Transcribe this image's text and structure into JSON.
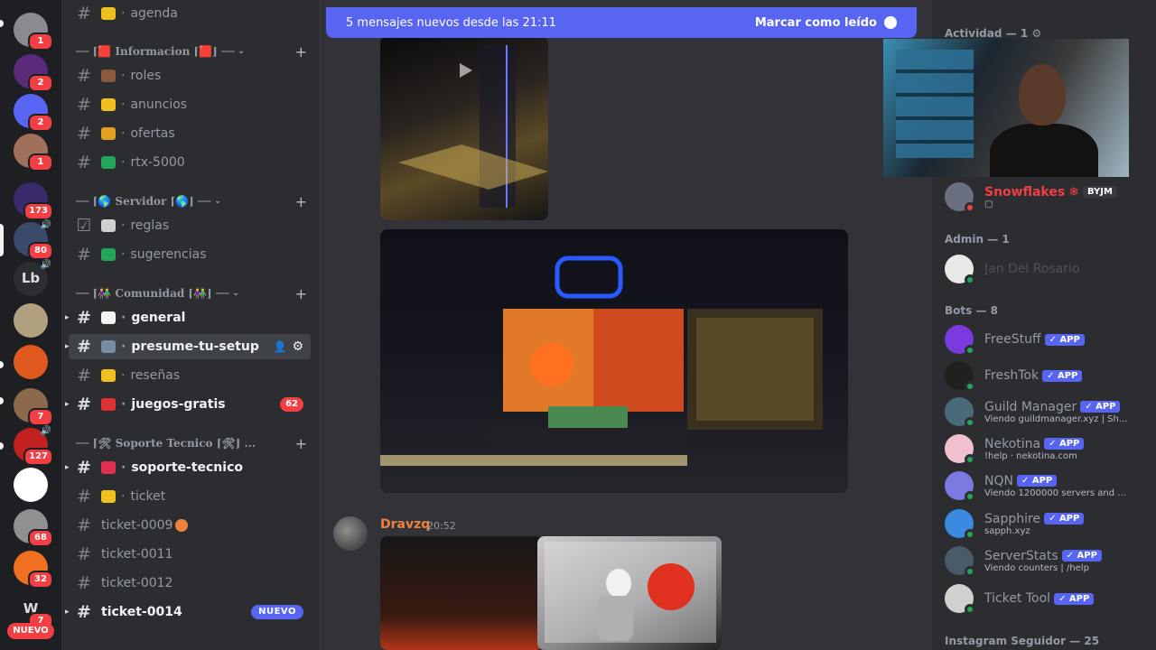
{
  "servers": [
    {
      "badge": "1",
      "color": "#8a8a90"
    },
    {
      "badge": "2",
      "color": "#5a2b7a"
    },
    {
      "badge": "2",
      "color": "#5865f2",
      "icon": "discord-icon"
    },
    {
      "badge": "1",
      "color": "#a0705a"
    },
    {
      "badge": "173",
      "color": "#3a2a6a"
    },
    {
      "badge": "80",
      "color": "#3a4a6a",
      "voice": true
    },
    {
      "badge": "",
      "color": "#2b2d31",
      "label": "Lb",
      "voice": true
    },
    {
      "badge": "",
      "color": "#b0a080"
    },
    {
      "badge": "",
      "color": "#e05a20"
    },
    {
      "badge": "7",
      "color": "#8a6a4a"
    },
    {
      "badge": "127",
      "color": "#c02020",
      "voice": true
    },
    {
      "badge": "",
      "color": "#ffffff"
    },
    {
      "badge": "68",
      "color": "#909090"
    },
    {
      "badge": "32",
      "color": "#f07020"
    },
    {
      "badge": "7",
      "color": "#1e1f22",
      "label": "W"
    }
  ],
  "rail_nuevo": "NUEVO",
  "channels": {
    "top": {
      "name": "agenda",
      "emoji_color": "#f0c020"
    },
    "cat_info": "── ⌈🟥 Informacion ⌈🟥⌋ ──",
    "cat_servidor": "── ⌈🌎 Servidor ⌈🌎⌋ ──",
    "cat_comunidad": "── ⌈👫 Comunidad ⌈👫⌋ ──",
    "cat_soporte": "── ⌈🛠 Soporte Tecnico ⌈🛠⌋ ...",
    "info_list": [
      {
        "name": "roles",
        "emoji_color": "#8a5a3a"
      },
      {
        "name": "anuncios",
        "emoji_color": "#f0c020"
      },
      {
        "name": "ofertas",
        "emoji_color": "#e0a020"
      },
      {
        "name": "rtx-5000",
        "emoji_color": "#23a55a"
      }
    ],
    "servidor_list": [
      {
        "name": "reglas",
        "emoji_color": "#d0d0d0"
      },
      {
        "name": "sugerencias",
        "emoji_color": "#23a55a"
      }
    ],
    "comunidad_list": [
      {
        "name": "general",
        "emoji_color": "#f2f3f5"
      },
      {
        "name": "presume-tu-setup",
        "emoji_color": "#7a8aa0"
      },
      {
        "name": "reseñas",
        "emoji_color": "#f0c020"
      },
      {
        "name": "juegos-gratis",
        "emoji_color": "#e03030",
        "count": "62"
      }
    ],
    "soporte_list": [
      {
        "name": "soporte-tecnico",
        "emoji_color": "#e03050"
      },
      {
        "name": "ticket",
        "emoji_color": "#f0c020"
      },
      {
        "name": "ticket-0009"
      },
      {
        "name": "ticket-0011"
      },
      {
        "name": "ticket-0012"
      },
      {
        "name": "ticket-0014",
        "tag": "NUEVO"
      }
    ]
  },
  "chat": {
    "banner_text": "5 mensajes nuevos desde las 21:11",
    "banner_action": "Marcar como leído",
    "author": "Dravzq",
    "time": "20:52"
  },
  "members": {
    "actividad_header": "Actividad — 1",
    "snowflakes": {
      "name": "Snowflakes",
      "tag": "BYJM"
    },
    "admin_header": "Admin — 1",
    "admin_name": "Jan Del Rosario",
    "bots_header": "Bots — 8",
    "app_label": "APP",
    "bots": [
      {
        "name": "FreeStuff",
        "sub": "",
        "color": "#7a3ae0"
      },
      {
        "name": "FreshTok",
        "sub": "",
        "color": "#202020"
      },
      {
        "name": "Guild Manager",
        "sub": "Viendo guildmanager.xyz | Sh...",
        "color": "#4a6a7a"
      },
      {
        "name": "Nekotina",
        "sub": "!help · nekotina.com",
        "color": "#f0c0d0"
      },
      {
        "name": "NQN",
        "sub": "Viendo 1200000 servers and ...",
        "color": "#7a7ae0"
      },
      {
        "name": "Sapphire",
        "sub": "sapph.xyz",
        "color": "#3a8ae0"
      },
      {
        "name": "ServerStats",
        "sub": "Viendo counters | /help",
        "color": "#4a5a6a"
      },
      {
        "name": "Ticket Tool",
        "sub": "",
        "color": "#d0d0d0"
      }
    ],
    "instagram_header": "Instagram Seguidor — 25"
  }
}
